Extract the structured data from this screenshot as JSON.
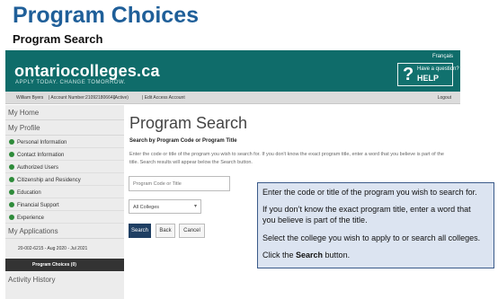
{
  "slide": {
    "title": "Program Choices",
    "subtitle": "Program Search"
  },
  "header": {
    "language_link": "Français",
    "brand": "ontariocolleges.ca",
    "tagline": "APPLY TODAY. CHANGE TOMORROW.",
    "help_small": "Have a question?",
    "help_big": "HELP",
    "help_symbol": "?"
  },
  "account_bar": {
    "name": "William Byers",
    "account_number": "| Account Number:210921806641",
    "status": "(Active)",
    "edit_link": "| Edit Access Account",
    "logout": "Logout"
  },
  "sidebar": {
    "my_home": "My Home",
    "my_profile": "My Profile",
    "profile_items": [
      "Personal Information",
      "Contact Information",
      "Authorized Users",
      "Citizenship and Residency",
      "Education",
      "Financial Support",
      "Experience"
    ],
    "my_applications": "My Applications",
    "application_entry": "20-002-6215 - Aug 2020 - Jul 2021",
    "active_item": "Program Choices (0)",
    "activity_history": "Activity History"
  },
  "main": {
    "page_title": "Program Search",
    "section_head": "Search by Program Code or Program Title",
    "instructions": "Enter the code or title of the program you wish to search for. If you don't know the exact program title, enter a word that you believe is part of the title. Search results will appear below the Search button.",
    "code_placeholder": "Program Code or Title",
    "college_select_value": "All Colleges",
    "buttons": {
      "search": "Search",
      "back": "Back",
      "cancel": "Cancel"
    }
  },
  "callout": {
    "line1": "Enter the code or title of the program you wish to search for.",
    "line2": "If you don’t know the exact program title, enter a word that",
    "line3": "you believe is part of the title.",
    "line4": "Select the college you wish to apply to or search all colleges.",
    "line5_prefix": "Click the ",
    "line5_bold": "Search",
    "line5_suffix": " button."
  },
  "colors": {
    "brand_teal": "#0f6c6a",
    "title_blue": "#1f5f99",
    "status_green": "#2e8b3a",
    "search_button": "#1f3f63",
    "callout_fill": "#dce4f1"
  }
}
